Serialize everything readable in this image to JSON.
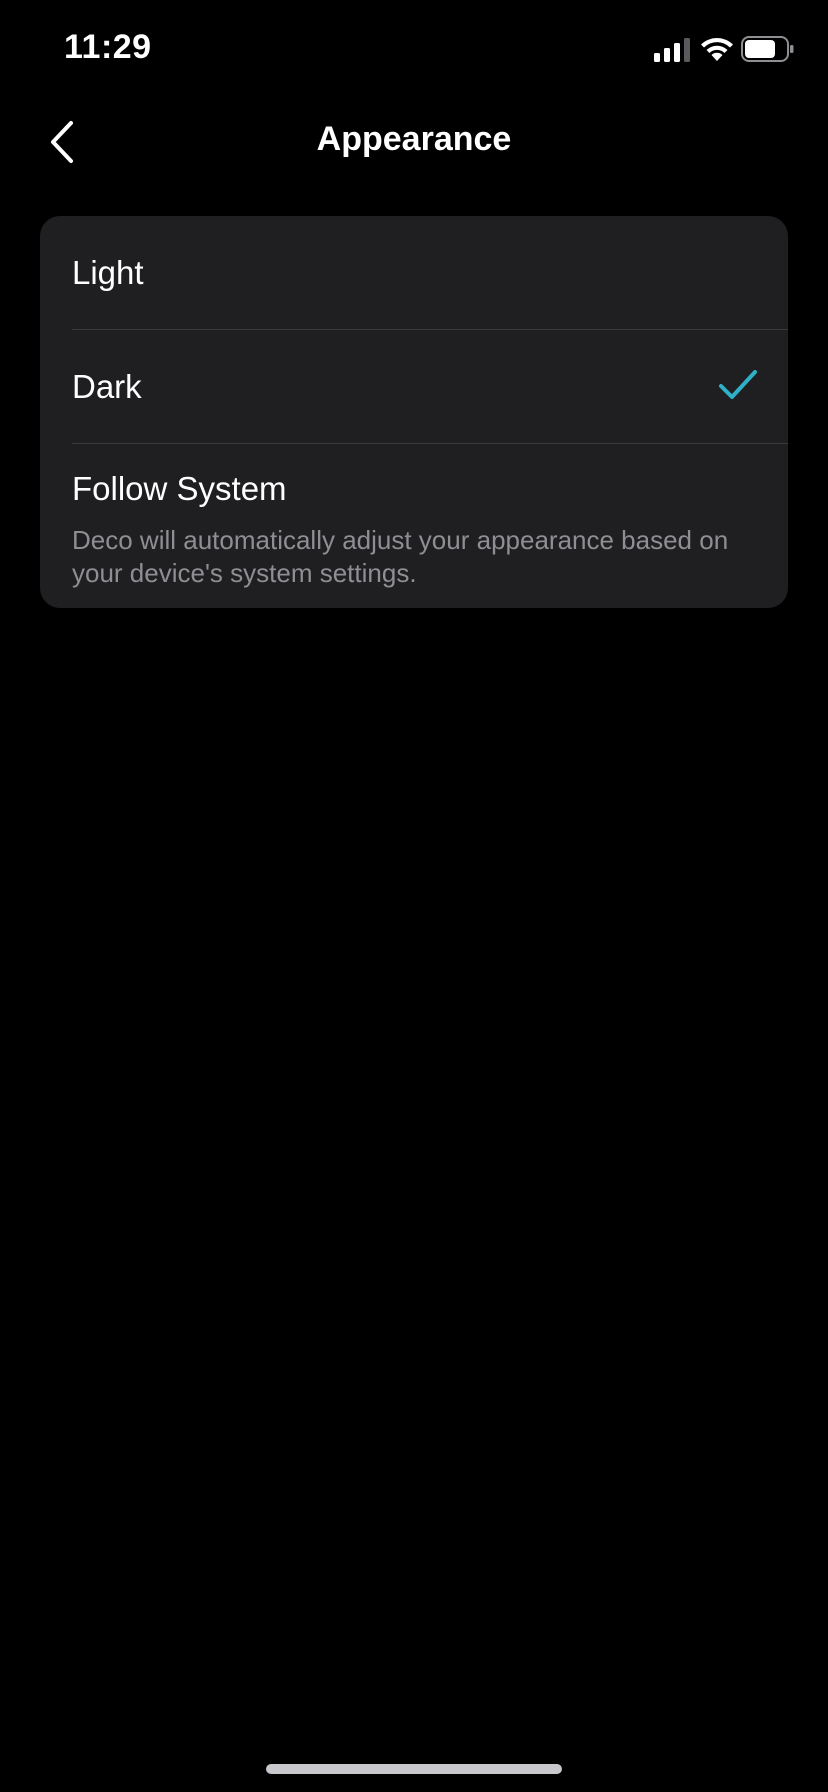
{
  "status_bar": {
    "time": "11:29",
    "icons": [
      "signal-icon",
      "wifi-icon",
      "battery-icon"
    ]
  },
  "nav": {
    "title": "Appearance",
    "back_icon": "chevron-left-icon"
  },
  "options": [
    {
      "label": "Light",
      "selected": false
    },
    {
      "label": "Dark",
      "selected": true
    },
    {
      "label": "Follow System",
      "description": "Deco will automatically adjust your appearance based on your device's system settings.",
      "selected": false
    }
  ],
  "colors": {
    "background": "#000000",
    "card": "#1f1f21",
    "accent_check": "#2fb0c8",
    "secondary_text": "#8e8e93"
  }
}
